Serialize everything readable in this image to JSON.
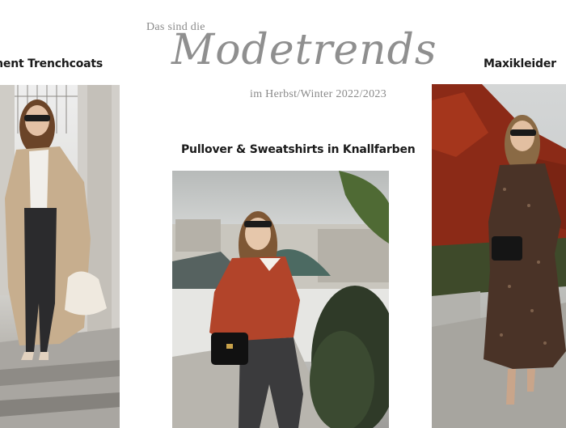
{
  "header": {
    "intro": "Das sind die",
    "title": "Modetrends",
    "season": "im Herbst/Winter 2022/2023"
  },
  "looks": [
    {
      "caption": "Statement Trenchcoats",
      "caption_visible": "tement Trenchcoats"
    },
    {
      "caption": "Pullover & Sweatshirts in Knallfarben"
    },
    {
      "caption": "Maxikleider"
    }
  ],
  "colors": {
    "title_gray": "#8f8f8f",
    "caption_black": "#1a1a1a",
    "trench_beige": "#c7ae8e",
    "sweater_rust": "#b2442a",
    "ivy_red": "#8b2a17"
  }
}
